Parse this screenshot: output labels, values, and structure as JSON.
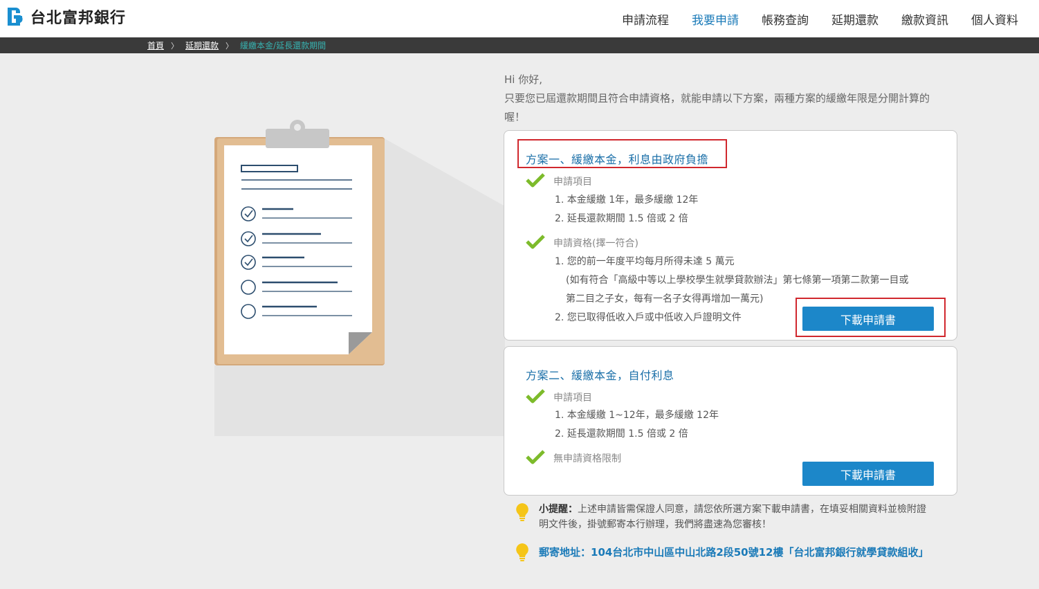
{
  "brand": {
    "name": "台北富邦銀行"
  },
  "nav": {
    "items": [
      {
        "label": "申請流程"
      },
      {
        "label": "我要申請"
      },
      {
        "label": "帳務查詢"
      },
      {
        "label": "延期還款"
      },
      {
        "label": "繳款資訊"
      },
      {
        "label": "個人資料"
      }
    ],
    "active": "我要申請"
  },
  "breadcrumb": {
    "home": "首頁",
    "section": "延期還款",
    "current": "緩繳本金/延長還款期間",
    "separator": "〉"
  },
  "intro": {
    "greeting": "Hi 你好,",
    "line1": "只要您已屆還款期間且符合申請資格，就能申請以下方案，兩種方案的緩繳年限是分開計算的",
    "line2": "喔！"
  },
  "plan1": {
    "title": "方案一、緩繳本金，利息由政府負擔",
    "apply_label": "申請項目",
    "apply_items": [
      "1. 本金緩繳 1年，最多緩繳 12年",
      "2. 延長還款期間 1.5 倍或 2 倍"
    ],
    "qual_label": "申請資格(擇一符合)",
    "qual_item1": "1. 您的前一年度平均每月所得未達 5 萬元",
    "qual_note1": "(如有符合「高級中等以上學校學生就學貸款辦法」第七條第一項第二款第一目或",
    "qual_note2": "第二目之子女，每有一名子女得再增加一萬元)",
    "qual_item2": "2. 您已取得低收入戶或中低收入戶證明文件",
    "button": "下載申請書"
  },
  "plan2": {
    "title": "方案二、緩繳本金，自付利息",
    "apply_label": "申請項目",
    "apply_items": [
      "1. 本金緩繳 1~12年，最多緩繳 12年",
      "2. 延長還款期間 1.5 倍或 2 倍"
    ],
    "qual_label": "無申請資格限制",
    "button": "下載申請書"
  },
  "tips": {
    "reminder_label": "小提醒：",
    "reminder_line1": "上述申請皆需保證人同意，請您依所選方案下載申請書，在填妥相關資料並檢附證",
    "reminder_line2": "明文件後，掛號郵寄本行辦理，我們將盡速為您審核！",
    "address": "郵寄地址：104台北市中山區中山北路2段50號12樓「台北富邦銀行就學貸款組收」"
  },
  "colors": {
    "accent": "#1a7ab8",
    "button": "#1c87c9",
    "check": "#7dbb2b",
    "highlight": "#d0272d",
    "breadcrumb_current": "#37b3b1"
  }
}
